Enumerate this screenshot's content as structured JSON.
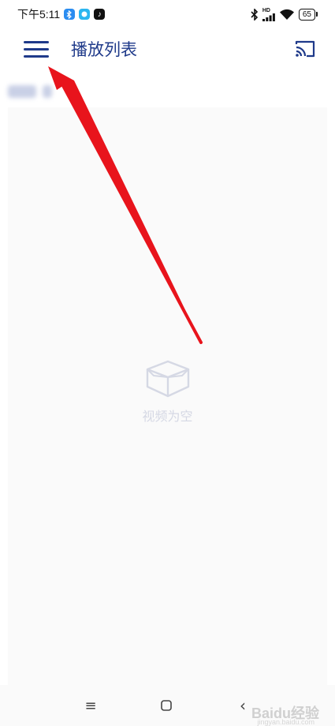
{
  "status_bar": {
    "time": "下午5:11",
    "battery": "65",
    "network": "HD"
  },
  "app_bar": {
    "title": "播放列表"
  },
  "empty_state": {
    "text": "视频为空"
  },
  "nav_bar": {
    "menu_glyph": "≡",
    "back_glyph": "‹"
  },
  "watermark": {
    "text": "Baidu经验",
    "url": "jingyan.baidu.com"
  },
  "colors": {
    "accent": "#1f3a8a",
    "arrow": "#e8141c",
    "empty_text": "#d5d8e4"
  },
  "icons": [
    "menu-icon",
    "cast-icon",
    "empty-box-icon",
    "bluetooth-icon",
    "wifi-icon",
    "battery-icon"
  ]
}
